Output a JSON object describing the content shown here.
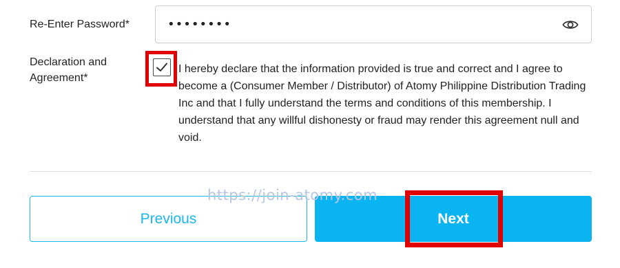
{
  "form": {
    "reenter_password_label": "Re-Enter Password*",
    "reenter_password_value": "••••••••",
    "password_toggle_icon": "eye-icon",
    "declaration_label": "Declaration and Agreement*",
    "declaration_checked": true,
    "declaration_text": "I hereby declare that the information provided is true and correct and I agree to become a (Consumer Member / Distributor) of Atomy Philippine Distribution Trading Inc and that I fully understand the terms and conditions of this membership. I understand that any willful dishonesty or fraud may render this agreement null and void."
  },
  "buttons": {
    "previous_label": "Previous",
    "next_label": "Next"
  },
  "watermark": "https://join-atomy.com",
  "colors": {
    "accent": "#0ab4f0",
    "highlight": "#e00000"
  }
}
